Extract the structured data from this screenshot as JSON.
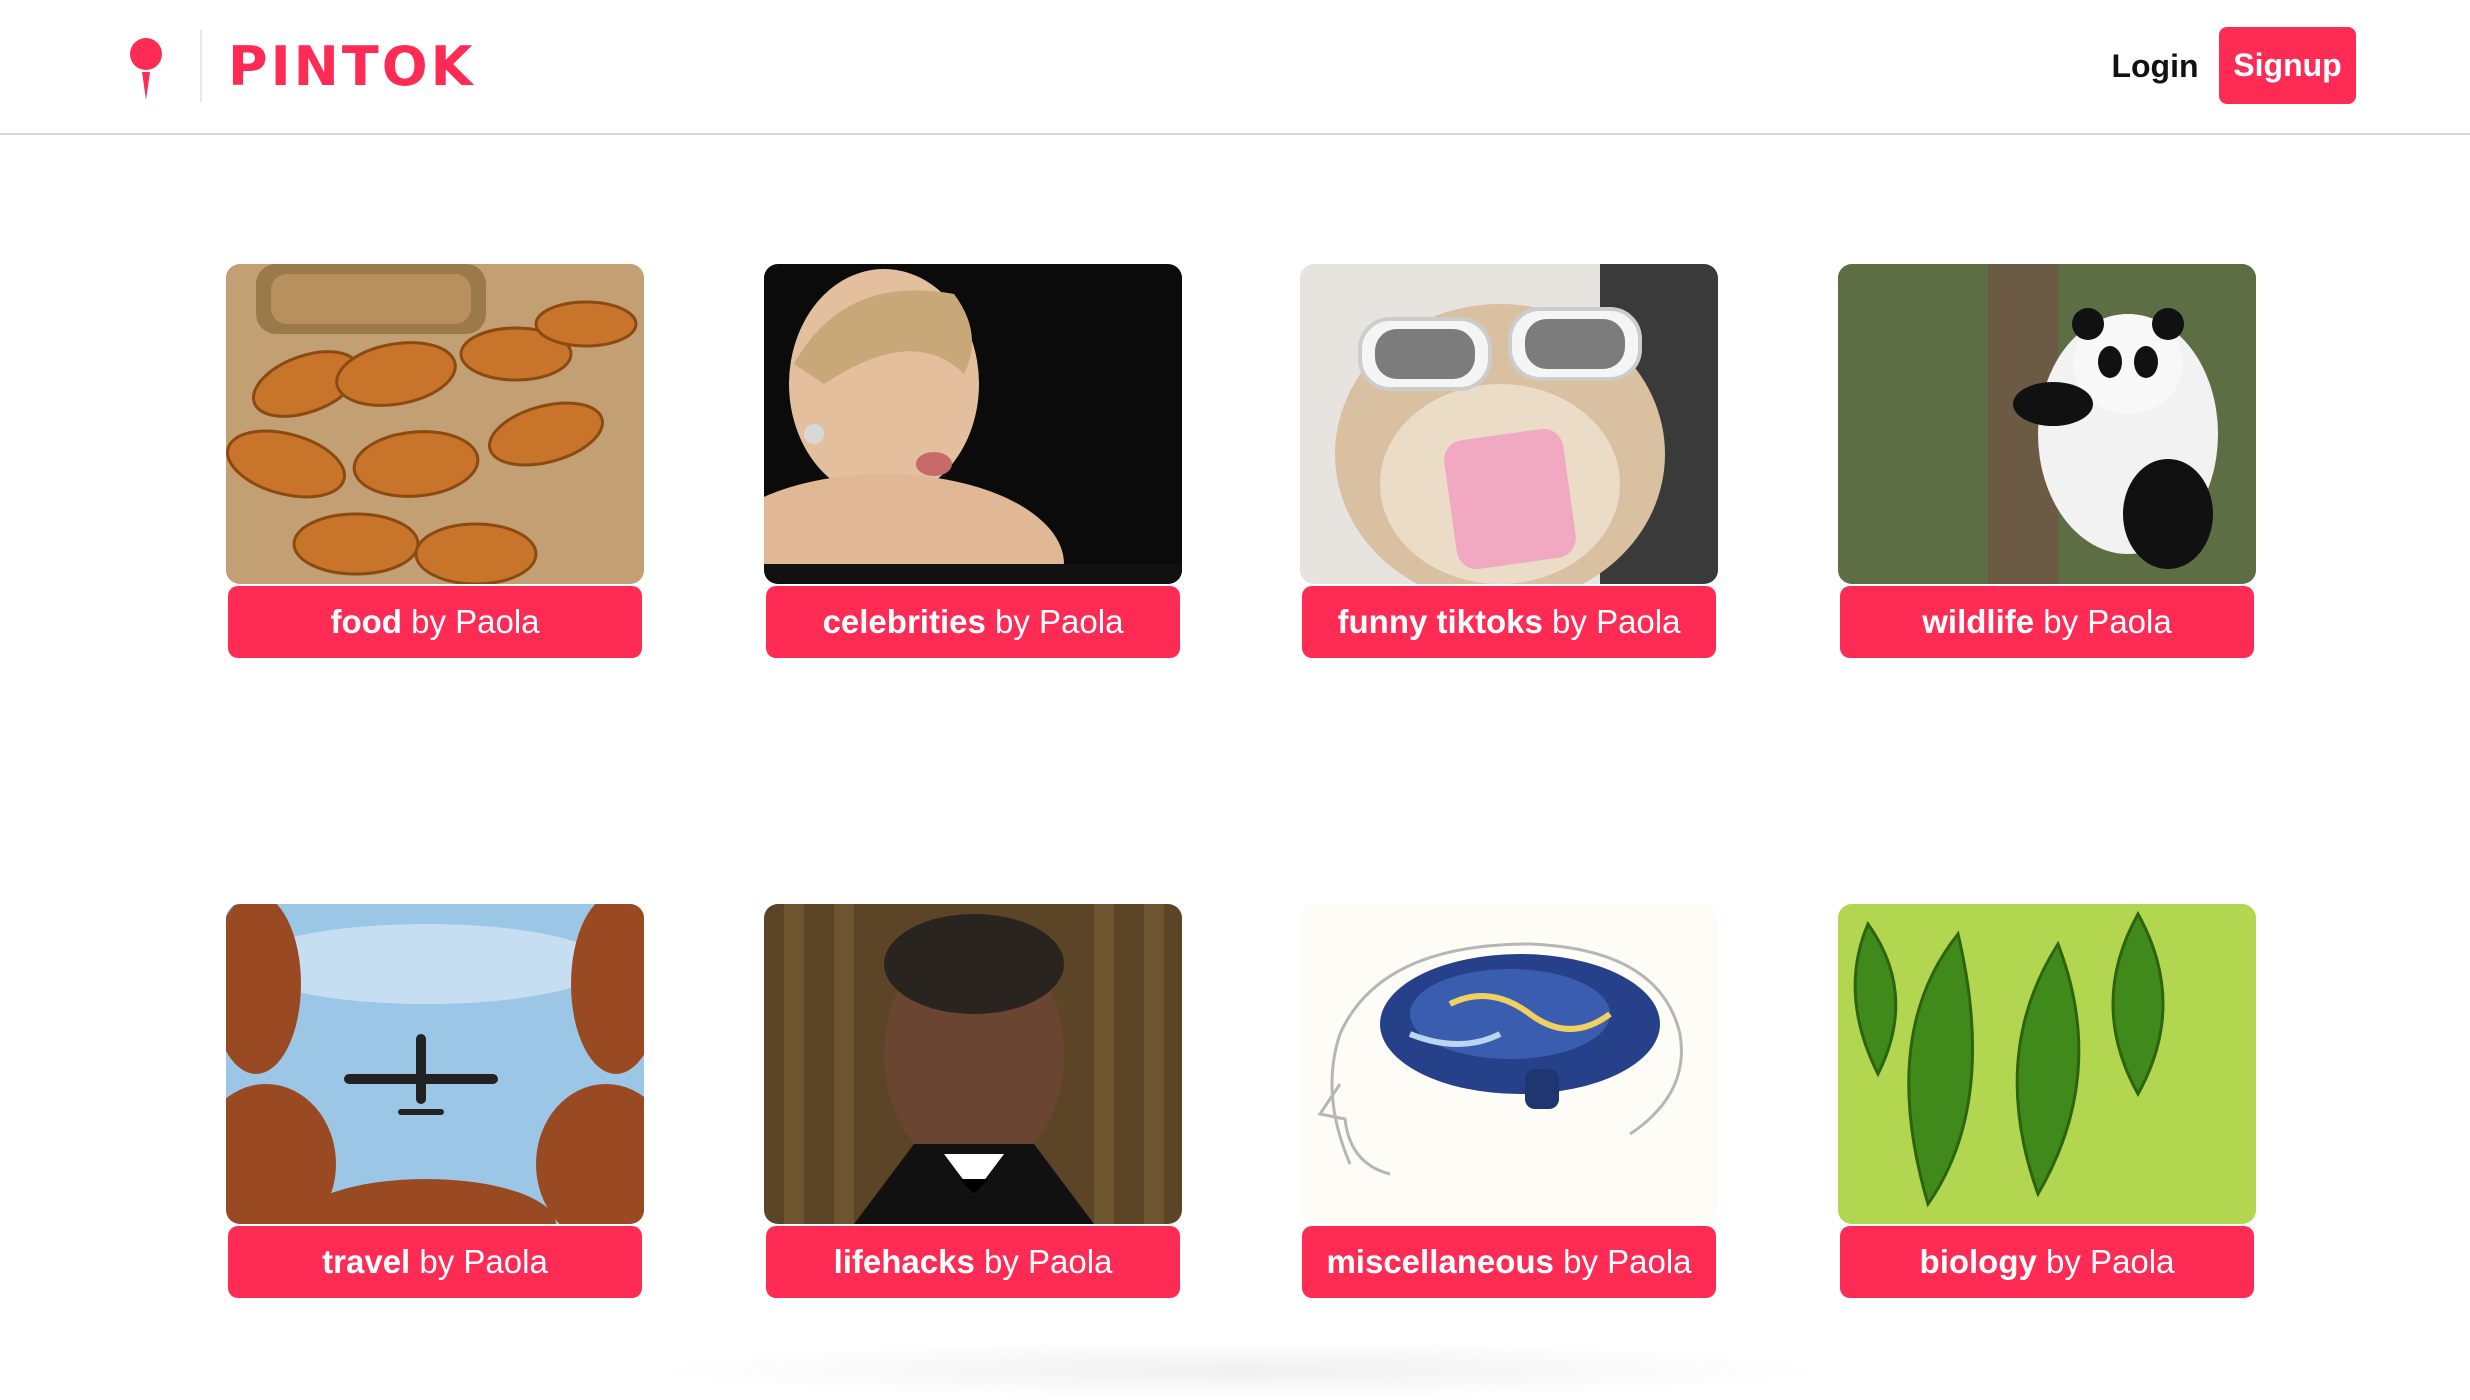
{
  "brand": {
    "name": "PINTOK",
    "accent": "#fe2c55",
    "pin_icon": "map-pin-icon"
  },
  "nav": {
    "login_label": "Login",
    "signup_label": "Signup"
  },
  "boards": [
    {
      "topic": "food",
      "by": "by Paola",
      "image": "croissants"
    },
    {
      "topic": "celebrities",
      "by": "by Paola",
      "image": "celebrity-portrait"
    },
    {
      "topic": "funny tiktoks",
      "by": "by Paola",
      "image": "hamster-sunglasses"
    },
    {
      "topic": "wildlife",
      "by": "by Paola",
      "image": "panda-on-tree"
    },
    {
      "topic": "travel",
      "by": "by Paola",
      "image": "airplane-sky"
    },
    {
      "topic": "lifehacks",
      "by": "by Paola",
      "image": "man-winking"
    },
    {
      "topic": "miscellaneous",
      "by": "by Paola",
      "image": "starry-brain"
    },
    {
      "topic": "biology",
      "by": "by Paola",
      "image": "green-leaves"
    }
  ]
}
